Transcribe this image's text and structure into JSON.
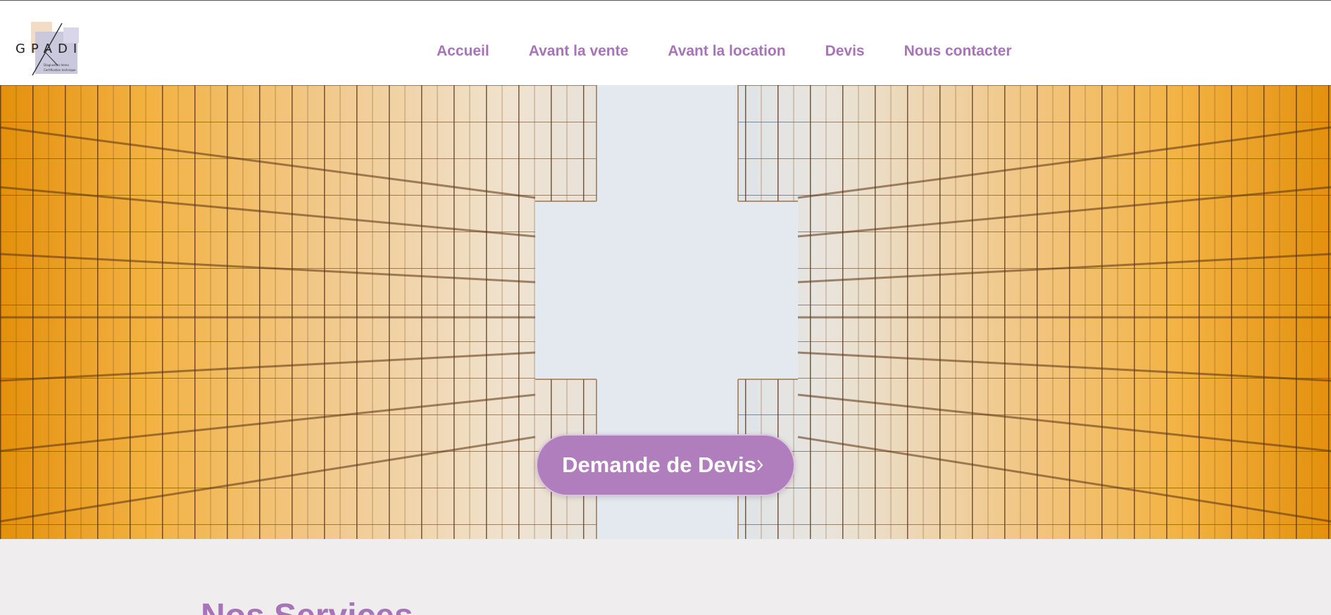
{
  "brand": {
    "name": "GPADI",
    "tagline_line1": "Diagnostics Immo",
    "tagline_line2": "Certification technique",
    "accent_color": "#a874b9"
  },
  "nav": {
    "items": [
      {
        "label": "Accueil"
      },
      {
        "label": "Avant la vente"
      },
      {
        "label": "Avant la location"
      },
      {
        "label": "Devis"
      },
      {
        "label": "Nous contacter"
      }
    ]
  },
  "hero": {
    "image": "glass-skyscrapers-looking-up",
    "cta_label": "Demande de Devis",
    "cta_icon": "chevron-right-icon",
    "cta_color": "#b07dbd"
  },
  "services": {
    "title": "Nos Services",
    "background": "#efeded"
  }
}
